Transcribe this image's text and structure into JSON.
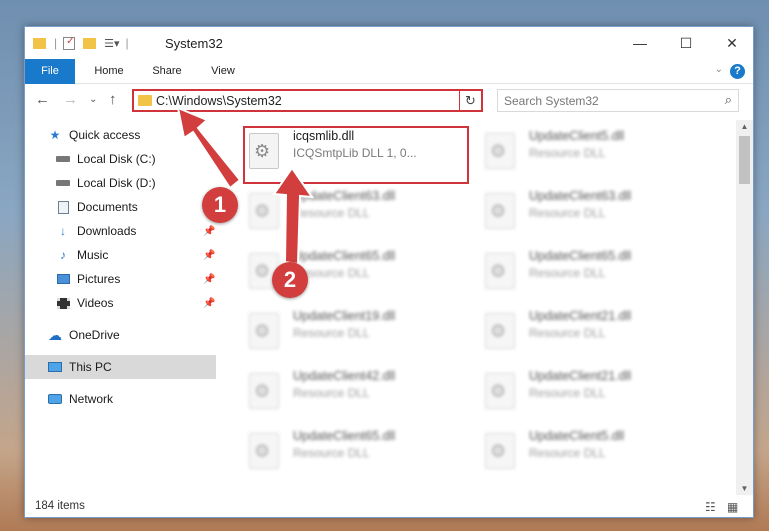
{
  "window": {
    "title": "System32",
    "controls": {
      "minimize": "—",
      "maximize": "☐",
      "close": "✕"
    }
  },
  "ribbon": {
    "tabs": [
      {
        "label": "File"
      },
      {
        "label": "Home"
      },
      {
        "label": "Share"
      },
      {
        "label": "View"
      }
    ],
    "help": "?"
  },
  "navbar": {
    "address": "C:\\Windows\\System32",
    "search_placeholder": "Search System32"
  },
  "sidebar": {
    "items": [
      {
        "label": "Quick access",
        "icon": "star-icon",
        "pinned": false
      },
      {
        "label": "Local Disk (C:)",
        "icon": "drive-icon",
        "pinned": false
      },
      {
        "label": "Local Disk (D:)",
        "icon": "drive-icon",
        "pinned": false
      },
      {
        "label": "Documents",
        "icon": "documents-icon",
        "pinned": true
      },
      {
        "label": "Downloads",
        "icon": "download-icon",
        "pinned": true
      },
      {
        "label": "Music",
        "icon": "music-icon",
        "pinned": true
      },
      {
        "label": "Pictures",
        "icon": "pictures-icon",
        "pinned": true
      },
      {
        "label": "Videos",
        "icon": "videos-icon",
        "pinned": true
      },
      {
        "label": "OneDrive",
        "icon": "cloud-icon",
        "pinned": false
      },
      {
        "label": "This PC",
        "icon": "computer-icon",
        "pinned": false,
        "selected": true
      },
      {
        "label": "Network",
        "icon": "network-icon",
        "pinned": false
      }
    ]
  },
  "files": [
    {
      "name": "icqsmlib.dll",
      "desc": "ICQSmtpLib DLL 1, 0..."
    },
    {
      "name": "UpdateClient5.dll",
      "desc": "Resource DLL"
    },
    {
      "name": "UpdateClient63.dll",
      "desc": "Resource DLL"
    },
    {
      "name": "UpdateClient63.dll",
      "desc": "Resource DLL"
    },
    {
      "name": "UpdateClient65.dll",
      "desc": "Resource DLL"
    },
    {
      "name": "UpdateClient65.dll",
      "desc": "Resource DLL"
    },
    {
      "name": "UpdateClient19.dll",
      "desc": "Resource DLL"
    },
    {
      "name": "UpdateClient21.dll",
      "desc": "Resource DLL"
    },
    {
      "name": "UpdateClient42.dll",
      "desc": "Resource DLL"
    },
    {
      "name": "UpdateClient21.dll",
      "desc": "Resource DLL"
    },
    {
      "name": "UpdateClient65.dll",
      "desc": "Resource DLL"
    },
    {
      "name": "UpdateClient5.dll",
      "desc": "Resource DLL"
    }
  ],
  "status": {
    "item_count": "184 items"
  },
  "callouts": {
    "one": "1",
    "two": "2"
  },
  "colors": {
    "accent": "#1979ca",
    "highlight": "#d0333a",
    "callout": "#d23d3d"
  }
}
